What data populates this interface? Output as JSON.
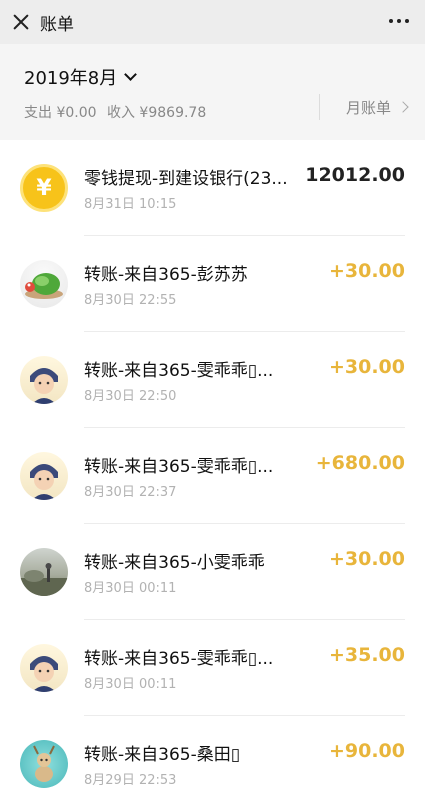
{
  "header": {
    "title": "账单"
  },
  "summary": {
    "month": "2019年8月",
    "expense": "支出 ¥0.00",
    "income": "收入 ¥9869.78",
    "monthly_bill_link": "月账单"
  },
  "transactions": [
    {
      "title": "零钱提现-到建设银行(23...",
      "time": "8月31日 10:15",
      "amount": "12012.00",
      "avatar": "coin-icon"
    },
    {
      "title": "转账-来自365-彭苏苏",
      "time": "8月30日 22:55",
      "amount": "+30.00",
      "avatar": "snail-avatar"
    },
    {
      "title": "转账-来自365-雯乖乖▯...",
      "time": "8月30日 22:50",
      "amount": "+30.00",
      "avatar": "child-avatar"
    },
    {
      "title": "转账-来自365-雯乖乖▯...",
      "time": "8月30日 22:37",
      "amount": "+680.00",
      "avatar": "child-avatar"
    },
    {
      "title": "转账-来自365-小雯乖乖",
      "time": "8月30日 00:11",
      "amount": "+30.00",
      "avatar": "landscape-avatar"
    },
    {
      "title": "转账-来自365-雯乖乖▯...",
      "time": "8月30日 00:11",
      "amount": "+35.00",
      "avatar": "child-avatar"
    },
    {
      "title": "转账-来自365-桑田▯",
      "time": "8月29日 22:53",
      "amount": "+90.00",
      "avatar": "deer-avatar"
    }
  ],
  "colors": {
    "income_amount": "#e8b53b",
    "coin": "#f7c31a",
    "header_bg": "#ededed",
    "summary_bg": "#f5f5f5"
  },
  "icons": {
    "coin_glyph": "¥"
  }
}
